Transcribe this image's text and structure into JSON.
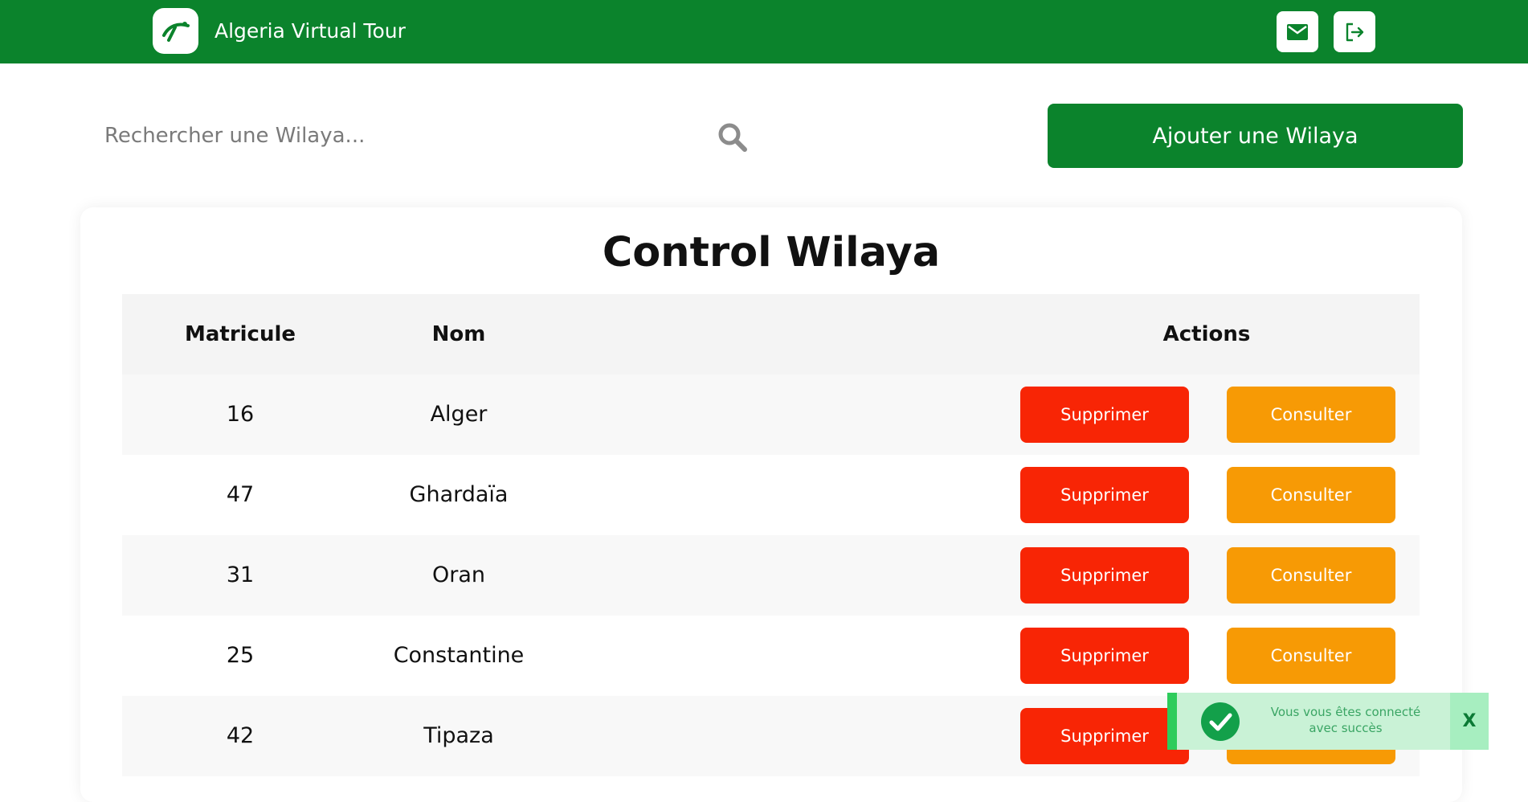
{
  "header": {
    "app_title": "Algeria Virtual Tour",
    "logo_icon": "runner-logo-icon",
    "mail_icon": "mail-icon",
    "logout_icon": "logout-icon"
  },
  "search": {
    "placeholder": "Rechercher une Wilaya...",
    "value": ""
  },
  "add_button_label": "Ajouter une Wilaya",
  "card": {
    "title": "Control Wilaya",
    "columns": [
      "Matricule",
      "Nom",
      "Actions"
    ],
    "rows": [
      {
        "matricule": "16",
        "nom": "Alger"
      },
      {
        "matricule": "47",
        "nom": "Ghardaïa"
      },
      {
        "matricule": "31",
        "nom": "Oran"
      },
      {
        "matricule": "25",
        "nom": "Constantine"
      },
      {
        "matricule": "42",
        "nom": "Tipaza"
      }
    ],
    "delete_label": "Supprimer",
    "view_label": "Consulter"
  },
  "toast": {
    "message": "Vous vous êtes connecté avec succès",
    "close_label": "X"
  },
  "colors": {
    "brand_green": "#0b832c",
    "delete_red": "#f82505",
    "view_orange": "#f79a05",
    "toast_bg": "#c9f2d6"
  }
}
